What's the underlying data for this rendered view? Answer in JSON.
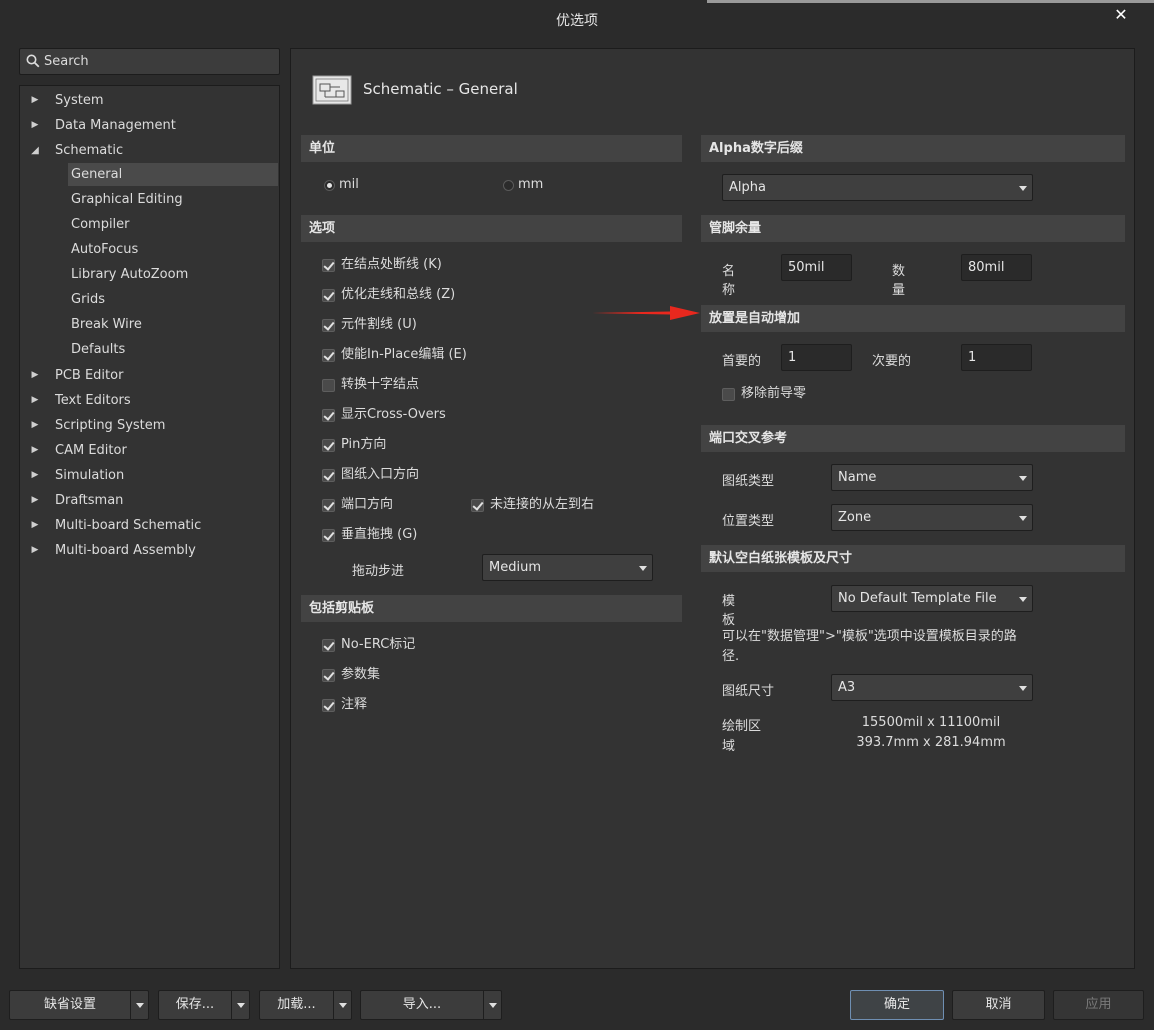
{
  "window": {
    "title": "优选项",
    "close_glyph": "✕"
  },
  "search": {
    "placeholder": "Search"
  },
  "tree": {
    "items": [
      {
        "label": "System",
        "expanded": false
      },
      {
        "label": "Data Management",
        "expanded": false
      },
      {
        "label": "Schematic",
        "expanded": true
      },
      {
        "label": "PCB Editor",
        "expanded": false
      },
      {
        "label": "Text Editors",
        "expanded": false
      },
      {
        "label": "Scripting System",
        "expanded": false
      },
      {
        "label": "CAM Editor",
        "expanded": false
      },
      {
        "label": "Simulation",
        "expanded": false
      },
      {
        "label": "Draftsman",
        "expanded": false
      },
      {
        "label": "Multi-board Schematic",
        "expanded": false
      },
      {
        "label": "Multi-board Assembly",
        "expanded": false
      }
    ],
    "schematic_children": [
      "General",
      "Graphical Editing",
      "Compiler",
      "AutoFocus",
      "Library AutoZoom",
      "Grids",
      "Break Wire",
      "Defaults"
    ],
    "selected": "General"
  },
  "page": {
    "title": "Schematic – General"
  },
  "units": {
    "header": "单位",
    "mil": "mil",
    "mm": "mm",
    "selected": "mil"
  },
  "options": {
    "header": "选项",
    "items": [
      {
        "label": "在结点处断线 (K)",
        "checked": true
      },
      {
        "label": "优化走线和总线 (Z)",
        "checked": true
      },
      {
        "label": "元件割线 (U)",
        "checked": true
      },
      {
        "label": "使能In-Place编辑 (E)",
        "checked": true
      },
      {
        "label": "转换十字结点",
        "checked": false
      },
      {
        "label": "显示Cross-Overs",
        "checked": true
      },
      {
        "label": "Pin方向",
        "checked": true
      },
      {
        "label": "图纸入口方向",
        "checked": true
      },
      {
        "label": "端口方向",
        "checked": true
      },
      {
        "label": "垂直拖拽 (G)",
        "checked": true
      }
    ],
    "unconnected_label": "未连接的从左到右",
    "unconnected_checked": true,
    "drag_step_label": "拖动步进",
    "drag_step_value": "Medium"
  },
  "clipboard": {
    "header": "包括剪贴板",
    "items": [
      {
        "label": "No-ERC标记",
        "checked": true
      },
      {
        "label": "参数集",
        "checked": true
      },
      {
        "label": "注释",
        "checked": true
      }
    ]
  },
  "alpha_suffix": {
    "header": "Alpha数字后缀",
    "value": "Alpha"
  },
  "pin_margin": {
    "header": "管脚余量",
    "name_label_1": "名",
    "name_label_2": "称",
    "name_value": "50mil",
    "number_label_1": "数",
    "number_label_2": "量",
    "number_value": "80mil"
  },
  "auto_increment": {
    "header": "放置是自动增加",
    "primary_label": "首要的",
    "primary_value": "1",
    "secondary_label": "次要的",
    "secondary_value": "1",
    "remove_zeros_label": "移除前导零",
    "remove_zeros_checked": false
  },
  "port_cross_ref": {
    "header": "端口交叉参考",
    "sheet_type_label": "图纸类型",
    "sheet_type_value": "Name",
    "location_type_label": "位置类型",
    "location_type_value": "Zone"
  },
  "default_sheet": {
    "header": "默认空白纸张模板及尺寸",
    "template_label_1": "模",
    "template_label_2": "板",
    "template_value": "No Default Template File",
    "hint_line_1": "可以在\"数据管理\">\"模板\"选项中设置模板目录的路",
    "hint_line_2": "径.",
    "sheet_size_label": "图纸尺寸",
    "sheet_size_value": "A3",
    "drawing_area_label_1": "绘制区",
    "drawing_area_label_2": "域",
    "drawing_area_mil": "15500mil x 11100mil",
    "drawing_area_mm": "393.7mm x 281.94mm"
  },
  "footer": {
    "defaults": "缺省设置",
    "save": "保存...",
    "load": "加载...",
    "import": "导入...",
    "ok": "确定",
    "cancel": "取消",
    "apply": "应用"
  },
  "colors": {
    "annotation_arrow": "#e8281e",
    "background": "#2b2b2b",
    "panel": "#333333",
    "section": "#434343"
  }
}
